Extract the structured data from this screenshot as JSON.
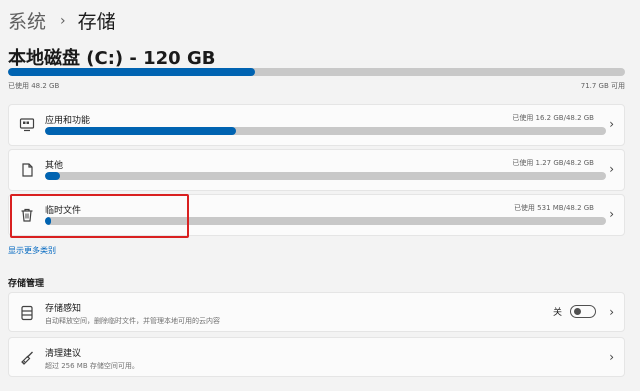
{
  "breadcrumb": {
    "parent": "系统",
    "separator": "›",
    "current": "存储"
  },
  "drive": {
    "title": "本地磁盘 (C:) - 120 GB",
    "used_label": "已使用 48.2 GB",
    "free_label": "71.7 GB 可用",
    "used_fraction": 0.4
  },
  "categories": [
    {
      "label": "应用和功能",
      "usage": "已使用 16.2 GB/48.2 GB",
      "fraction": 0.336,
      "icon": "apps-icon"
    },
    {
      "label": "其他",
      "usage": "已使用 1.27 GB/48.2 GB",
      "fraction": 0.026,
      "icon": "document-icon"
    },
    {
      "label": "临时文件",
      "usage": "已使用 531 MB/48.2 GB",
      "fraction": 0.011,
      "icon": "trash-icon"
    }
  ],
  "show_more": "显示更多类别",
  "management": {
    "title": "存储管理",
    "items": [
      {
        "label": "存储感知",
        "desc": "自动释放空间，删除临时文件，并管理本地可用的云内容",
        "toggle_state": "关",
        "toggle_on": false,
        "icon": "storage-sense-icon"
      },
      {
        "label": "清理建议",
        "desc": "超过 256 MB 存储空间可用。",
        "icon": "broom-icon"
      }
    ]
  },
  "colors": {
    "accent": "#0063b1",
    "highlight": "#d92020",
    "link": "#0067c0"
  }
}
